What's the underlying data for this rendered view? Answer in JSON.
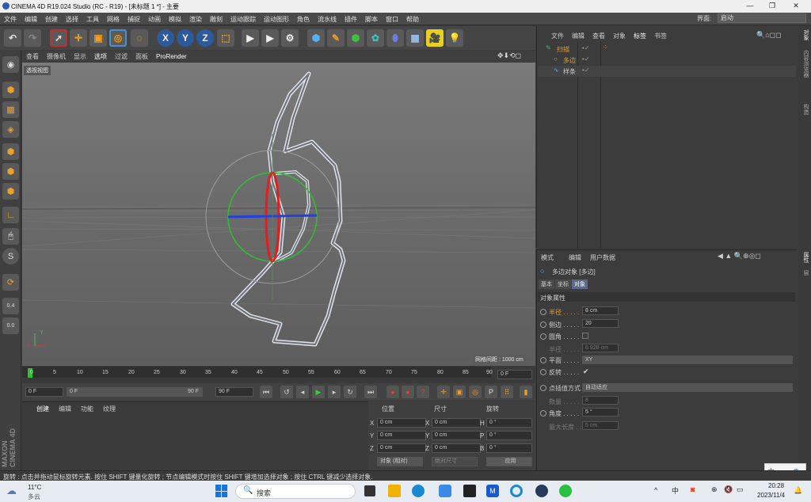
{
  "window": {
    "title": "CINEMA 4D R19.024 Studio (RC - R19) - [未标题 1 *] - 主要"
  },
  "menu": [
    "文件",
    "编辑",
    "创建",
    "选择",
    "工具",
    "网格",
    "捕捉",
    "动画",
    "模拟",
    "渲染",
    "雕刻",
    "运动跟踪",
    "运动图形",
    "角色",
    "流水线",
    "插件",
    "脚本",
    "窗口",
    "帮助"
  ],
  "layout": {
    "label": "界面:",
    "value": "启动"
  },
  "viewport": {
    "menu": [
      "查看",
      "摄像机",
      "显示",
      "选项",
      "过滤",
      "面板",
      "ProRender"
    ],
    "label": "透视视图",
    "grid_spacing": "网格间距 : 1000 cm"
  },
  "timeline": {
    "ticks": [
      "0",
      "5",
      "10",
      "15",
      "20",
      "25",
      "30",
      "35",
      "40",
      "45",
      "50",
      "55",
      "60",
      "65",
      "70",
      "75",
      "80",
      "85",
      "90"
    ],
    "end_field": "0 F"
  },
  "transport": {
    "current": "0 F",
    "slider_start": "0 F",
    "slider_end": "90 F",
    "end": "90 F"
  },
  "material_menu": [
    "创建",
    "编辑",
    "功能",
    "纹理"
  ],
  "maxon_logo": "MAXON CINEMA 4D",
  "coords": {
    "headers": [
      "位置",
      "尺寸",
      "旋转"
    ],
    "rows": [
      {
        "a": "X",
        "pos": "0 cm",
        "b": "X",
        "size": "0 cm",
        "c": "H",
        "rot": "0 °"
      },
      {
        "a": "Y",
        "pos": "0 cm",
        "b": "Y",
        "size": "0 cm",
        "c": "P",
        "rot": "0 °"
      },
      {
        "a": "Z",
        "pos": "0 cm",
        "b": "Z",
        "size": "0 cm",
        "c": "B",
        "rot": "0 °"
      }
    ],
    "mode": "对象 (相对)",
    "size_mode": "绝对尺寸",
    "apply": "应用"
  },
  "objects": {
    "menu": [
      "文件",
      "编辑",
      "查看",
      "对象",
      "标签",
      "书签"
    ],
    "items": [
      {
        "name": "扫描"
      },
      {
        "name": "多边"
      },
      {
        "name": "样条"
      }
    ]
  },
  "attributes": {
    "menu": [
      "模式",
      "编辑",
      "用户数据"
    ],
    "object_title": "多边对象 [多边]",
    "tabs": [
      "基本",
      "坐标",
      "对象"
    ],
    "section": "对象属性",
    "fields": [
      {
        "label": "半径 . . . . .",
        "value": "8 cm"
      },
      {
        "label": "侧边 . . . . .",
        "value": "20"
      },
      {
        "label": "圆角 . . . . .",
        "value": ""
      },
      {
        "label": "半径 . . . . .",
        "value": "6.928 cm"
      },
      {
        "label": "平面 . . . . .",
        "value": "XY"
      },
      {
        "label": "反转 . . . . .",
        "value": "✔"
      },
      {
        "label": "点插值方式",
        "value": "自动适应"
      },
      {
        "label": "数量 . . . . .",
        "value": "8"
      },
      {
        "label": "角度 . . . . .",
        "value": "5 °"
      },
      {
        "label": "最大长度 . .",
        "value": "5 cm"
      }
    ]
  },
  "right_tabs": [
    "对象",
    "内容浏览器",
    "构造",
    "属性",
    "层"
  ],
  "status": "旋转 : 点击并拖动鼠标旋转元素. 按住 SHIFT 键量化旋转 ; 节点编辑模式时按住 SHIFT 键增加选择对象 ; 按住 CTRL 键减少选择对象.",
  "taskbar": {
    "weather_temp": "11°C",
    "weather_desc": "多云",
    "search": "搜索",
    "time": "20:28",
    "date": "2023/11/4",
    "ime": "中"
  }
}
